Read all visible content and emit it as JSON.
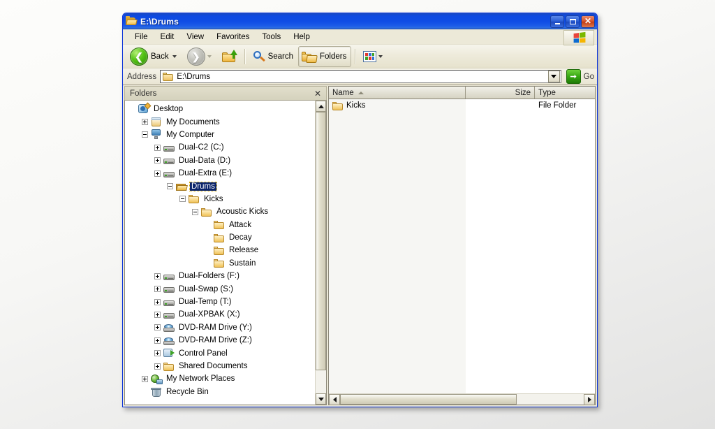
{
  "window": {
    "title": "E:\\Drums",
    "title_icon": "folder-open-icon",
    "minimize_label": "Minimize",
    "maximize_label": "Maximize",
    "close_label": "Close"
  },
  "menubar": {
    "items": [
      {
        "label": "File"
      },
      {
        "label": "Edit"
      },
      {
        "label": "View"
      },
      {
        "label": "Favorites"
      },
      {
        "label": "Tools"
      },
      {
        "label": "Help"
      }
    ],
    "brand_icon": "windows-flag-icon"
  },
  "toolbar": {
    "back_label": "Back",
    "back_icon": "back-arrow-icon",
    "forward_icon": "forward-arrow-icon",
    "up_icon": "up-one-level-icon",
    "search_label": "Search",
    "search_icon": "magnifier-icon",
    "folders_label": "Folders",
    "folders_icon": "folders-icon",
    "folders_pressed": true,
    "views_icon": "views-grid-icon"
  },
  "address": {
    "label": "Address",
    "icon": "folder-icon",
    "value": "E:\\Drums",
    "placeholder": "",
    "dropdown_icon": "chevron-down-icon",
    "go_label": "Go",
    "go_icon": "go-arrow-icon"
  },
  "folders_pane": {
    "title": "Folders",
    "close_label": "✕",
    "scroll": {
      "up_icon": "scroll-up-icon",
      "down_icon": "scroll-down-icon"
    },
    "tree": [
      {
        "label": "Desktop",
        "depth": 0,
        "expander": "none",
        "icon": "desktop-icon",
        "selected": false
      },
      {
        "label": "My Documents",
        "depth": 1,
        "expander": "plus",
        "icon": "my-documents-icon",
        "selected": false
      },
      {
        "label": "My Computer",
        "depth": 1,
        "expander": "minus",
        "icon": "my-computer-icon",
        "selected": false
      },
      {
        "label": "Dual-C2 (C:)",
        "depth": 2,
        "expander": "plus",
        "icon": "hard-drive-icon",
        "selected": false
      },
      {
        "label": "Dual-Data (D:)",
        "depth": 2,
        "expander": "plus",
        "icon": "hard-drive-icon",
        "selected": false
      },
      {
        "label": "Dual-Extra (E:)",
        "depth": 2,
        "expander": "plus",
        "icon": "hard-drive-icon",
        "selected": false
      },
      {
        "label": "Drums",
        "depth": 3,
        "expander": "minus",
        "icon": "folder-open-icon",
        "selected": true
      },
      {
        "label": "Kicks",
        "depth": 4,
        "expander": "minus",
        "icon": "folder-icon",
        "selected": false
      },
      {
        "label": "Acoustic Kicks",
        "depth": 5,
        "expander": "minus",
        "icon": "folder-icon",
        "selected": false
      },
      {
        "label": "Attack",
        "depth": 6,
        "expander": "none",
        "icon": "folder-icon",
        "selected": false
      },
      {
        "label": "Decay",
        "depth": 6,
        "expander": "none",
        "icon": "folder-icon",
        "selected": false
      },
      {
        "label": "Release",
        "depth": 6,
        "expander": "none",
        "icon": "folder-icon",
        "selected": false
      },
      {
        "label": "Sustain",
        "depth": 6,
        "expander": "none",
        "icon": "folder-icon",
        "selected": false
      },
      {
        "label": "Dual-Folders (F:)",
        "depth": 2,
        "expander": "plus",
        "icon": "hard-drive-icon",
        "selected": false
      },
      {
        "label": "Dual-Swap (S:)",
        "depth": 2,
        "expander": "plus",
        "icon": "hard-drive-icon",
        "selected": false
      },
      {
        "label": "Dual-Temp (T:)",
        "depth": 2,
        "expander": "plus",
        "icon": "hard-drive-icon",
        "selected": false
      },
      {
        "label": "Dual-XPBAK (X:)",
        "depth": 2,
        "expander": "plus",
        "icon": "hard-drive-icon",
        "selected": false
      },
      {
        "label": "DVD-RAM Drive (Y:)",
        "depth": 2,
        "expander": "plus",
        "icon": "dvd-drive-icon",
        "selected": false
      },
      {
        "label": "DVD-RAM Drive (Z:)",
        "depth": 2,
        "expander": "plus",
        "icon": "dvd-drive-icon",
        "selected": false
      },
      {
        "label": "Control Panel",
        "depth": 2,
        "expander": "plus",
        "icon": "control-panel-icon",
        "selected": false
      },
      {
        "label": "Shared Documents",
        "depth": 2,
        "expander": "plus",
        "icon": "folder-icon",
        "selected": false
      },
      {
        "label": "My Network Places",
        "depth": 1,
        "expander": "plus",
        "icon": "network-icon",
        "selected": false
      },
      {
        "label": "Recycle Bin",
        "depth": 1,
        "expander": "none",
        "icon": "recycle-bin-icon",
        "selected": false
      }
    ]
  },
  "file_list": {
    "columns": [
      {
        "label": "Name",
        "sorted": "asc"
      },
      {
        "label": "Size",
        "sorted": ""
      },
      {
        "label": "Type",
        "sorted": ""
      }
    ],
    "rows": [
      {
        "name": "Kicks",
        "size": "",
        "type": "File Folder",
        "icon": "folder-icon"
      }
    ],
    "scroll": {
      "left_icon": "scroll-left-icon",
      "right_icon": "scroll-right-icon"
    }
  },
  "colors": {
    "titlebar_blue": "#0f4ce5",
    "selection_navy": "#0a246a",
    "chrome_tan": "#ece9d8",
    "accent_green": "#36a712"
  }
}
